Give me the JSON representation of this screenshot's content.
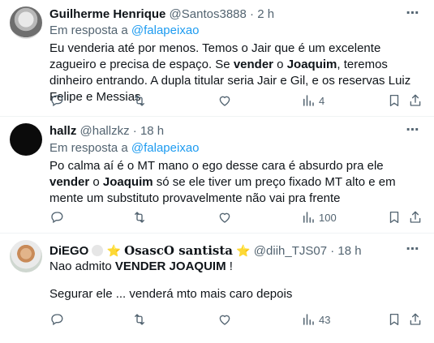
{
  "tweets": [
    {
      "name": "Guilherme Henrique",
      "handle": "@Santos3888",
      "sep": "·",
      "time": "2 h",
      "reply_prefix": "Em resposta a",
      "reply_to": "@falapeixao",
      "text_1": "Eu venderia até por menos. Temos o Jair que é um excelente zagueiro e precisa de espaço. Se ",
      "text_b1": "vender",
      "text_2": " o ",
      "text_b2": "Joaquim",
      "text_3": ", teremos dinheiro entrando. A dupla titular seria Jair e Gil, e os reservas Luiz Felipe e Messias",
      "views": "4"
    },
    {
      "name": "hallz",
      "handle": "@hallzkz",
      "sep": "·",
      "time": "18 h",
      "reply_prefix": "Em resposta a",
      "reply_to": "@falapeixao",
      "text_1": "Po calma aí é o MT mano o ego desse cara é absurdo pra ele ",
      "text_b1": "vender",
      "text_2": " o ",
      "text_b2": "Joaquim",
      "text_3": " só se ele tiver um preço fixado MT alto e em mente um substituto provavelmente não vai pra frente",
      "views": "100"
    },
    {
      "name": "DiEGO",
      "star1": "⭐",
      "fancy_name": "OsascO santista",
      "star2": "⭐",
      "handle": "@diih_TJS07",
      "sep": "·",
      "time": "18 h",
      "text_1": "Nao admito ",
      "text_b1": "VENDER JOAQUIM",
      "text_2": " !",
      "text_line2": "Segurar ele ... venderá mto mais caro depois",
      "views": "43"
    }
  ],
  "more_icon": "⋯",
  "icons": [
    "reply-icon",
    "retweet-icon",
    "like-icon",
    "views-icon",
    "bookmark-icon",
    "share-icon"
  ]
}
